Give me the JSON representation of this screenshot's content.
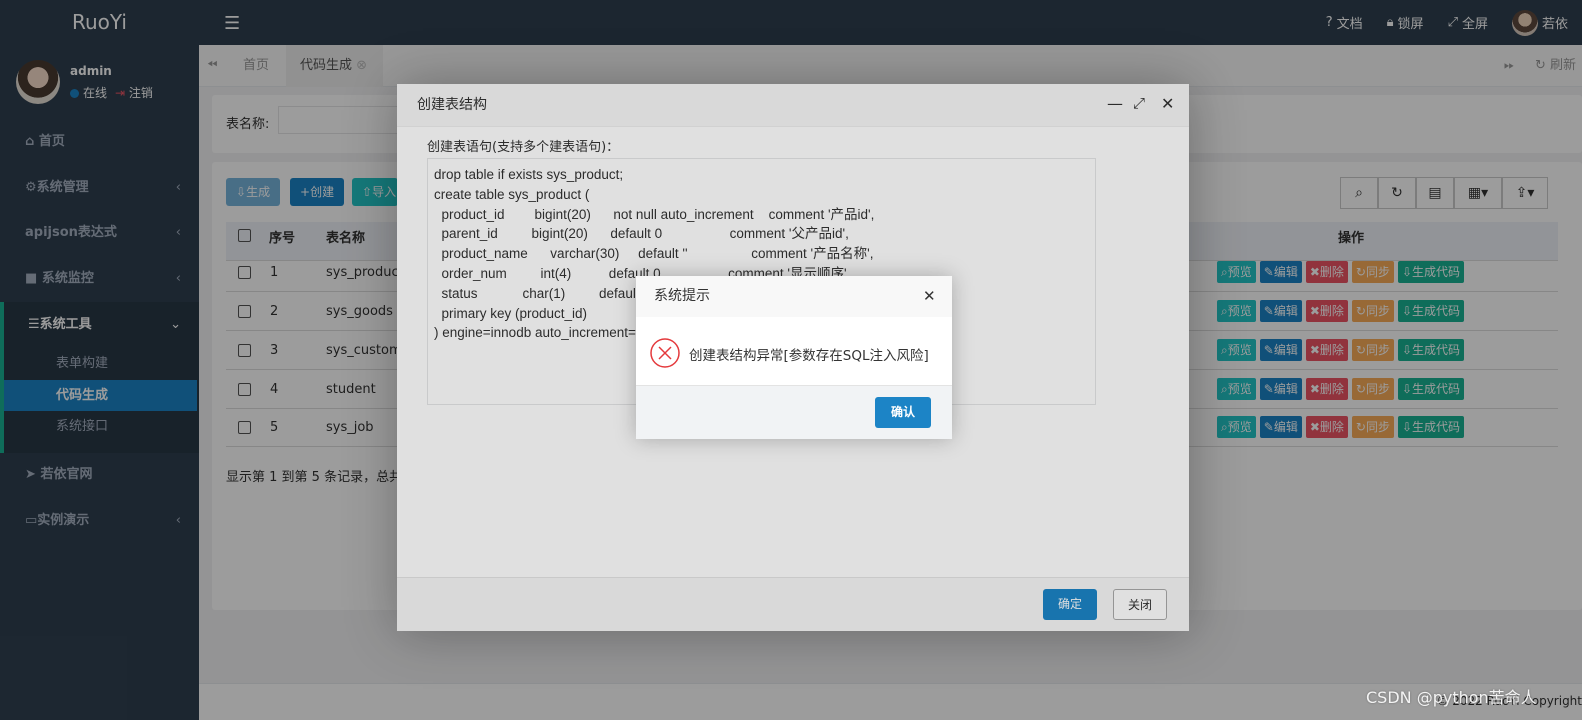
{
  "app": {
    "logo": "RuoYi"
  },
  "topnav": {
    "docs": "文档",
    "lock": "锁屏",
    "fullscreen": "全屏",
    "user_short": "若依"
  },
  "user": {
    "name": "admin",
    "status": "在线",
    "logout": "注销"
  },
  "sidebar": {
    "items": [
      {
        "label": "首页",
        "icon": "home-icon"
      },
      {
        "label": "系统管理",
        "icon": "gear-icon"
      },
      {
        "label": "apijson表达式"
      },
      {
        "label": "系统监控",
        "icon": "video-icon"
      },
      {
        "label": "系统工具",
        "icon": "list-icon"
      },
      {
        "label": "若依官网",
        "icon": "send-icon"
      },
      {
        "label": "实例演示",
        "icon": "desktop-icon"
      }
    ],
    "submenu": [
      "表单构建",
      "代码生成",
      "系统接口"
    ]
  },
  "tabs": {
    "home": "首页",
    "codegen": "代码生成",
    "refresh": "刷新"
  },
  "search": {
    "table_name_label": "表名称:"
  },
  "toolbar": {
    "generate": "生成",
    "create": "创建",
    "import": "导入"
  },
  "table": {
    "headers": {
      "seq": "序号",
      "name": "表名称",
      "ops": "操作"
    },
    "rows": [
      {
        "seq": "1",
        "name": "sys_product"
      },
      {
        "seq": "2",
        "name": "sys_goods"
      },
      {
        "seq": "3",
        "name": "sys_custome"
      },
      {
        "seq": "4",
        "name": "student"
      },
      {
        "seq": "5",
        "name": "sys_job"
      }
    ],
    "ops": {
      "preview": "预览",
      "edit": "编辑",
      "delete": "删除",
      "sync": "同步",
      "gencode": "生成代码"
    },
    "pagination": "显示第 1 到第 5 条记录，总共"
  },
  "footer": {
    "copyright": "© 2022 RuoYi Copyright"
  },
  "watermark": "CSDN @python苦命人",
  "layer": {
    "title": "创建表结构",
    "sql_label": "创建表语句(支持多个建表语句)：",
    "sql": "drop table if exists sys_product;\ncreate table sys_product (\n  product_id        bigint(20)      not null auto_increment    comment '产品id',\n  parent_id         bigint(20)      default 0                  comment '父产品id',\n  product_name      varchar(30)     default ''                 comment '产品名称',\n  order_num         int(4)          default 0                  comment '显示顺序',\n  status            char(1)         default\n  primary key (product_id)\n) engine=innodb auto_increment=",
    "confirm": "确定",
    "close": "关闭"
  },
  "dialog": {
    "title": "系统提示",
    "message": "创建表结构异常[参数存在SQL注入风险]",
    "ok": "确认"
  },
  "colors": {
    "sidebar": "#2f4050",
    "primary": "#1c84c6",
    "info": "#23c6c8",
    "danger": "#ed5565",
    "warning": "#f8ac59",
    "success": "#1ab394"
  }
}
